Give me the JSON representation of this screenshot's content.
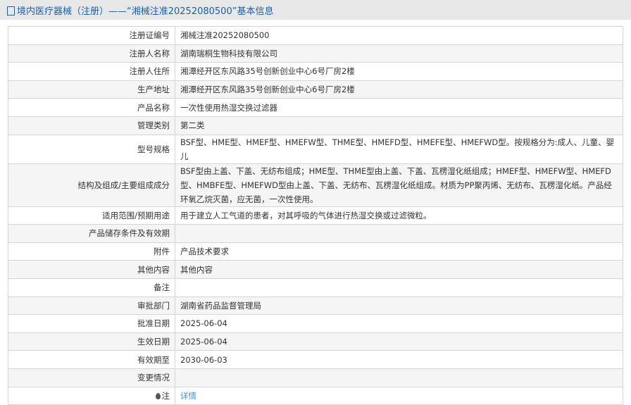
{
  "header": {
    "title": "境内医疗器械（注册）——“湘械注准20252080500”基本信息"
  },
  "rows": [
    {
      "label": "注册证编号",
      "value": "湘械注准20252080500"
    },
    {
      "label": "注册人名称",
      "value": "湖南瑞桐生物科技有限公司"
    },
    {
      "label": "注册人住所",
      "value": "湘潭经开区东风路35号创新创业中心6号厂房2楼"
    },
    {
      "label": "生产地址",
      "value": "湘潭经开区东风路35号创新创业中心6号厂房2楼"
    },
    {
      "label": "产品名称",
      "value": "一次性使用热湿交换过滤器"
    },
    {
      "label": "管理类别",
      "value": "第二类"
    },
    {
      "label": "型号规格",
      "value": "BSF型、HME型、HMEF型、HMEFW型、THME型、HMEFD型、HMEFE型、HMEFWD型。按规格分为:成人、儿童、婴儿"
    },
    {
      "label": "结构及组成/主要组成成分",
      "value": "BSF型由上盖、下盖、无纺布组成；HME型、THME型由上盖、下盖、瓦楞湿化纸组成；HMEF型、HMEFW型、HMEFD型、HMBFE型、HMEFWD型由上盖、下盖、无纺布、瓦楞湿化纸组成。材质为PP聚丙烯、无纺布、瓦楞湿化纸。产品经环氧乙烷灭菌，应无菌，一次性使用。"
    },
    {
      "label": "适用范围/预期用途",
      "value": "用于建立人工气道的患者，对其呼吸的气体进行热湿交换或过滤微粒。"
    },
    {
      "label": "产品储存条件及有效期",
      "value": ""
    },
    {
      "label": "附件",
      "value": "产品技术要求"
    },
    {
      "label": "其他内容",
      "value": "其他内容"
    },
    {
      "label": "备注",
      "value": ""
    },
    {
      "label": "审批部门",
      "value": "湖南省药品监督管理局"
    },
    {
      "label": "批准日期",
      "value": "2025-06-04"
    },
    {
      "label": "生效日期",
      "value": "2025-06-04"
    },
    {
      "label": "有效期至",
      "value": "2030-06-03"
    },
    {
      "label": "变更情况",
      "value": ""
    }
  ],
  "note": {
    "label": "注",
    "link": "详情"
  }
}
